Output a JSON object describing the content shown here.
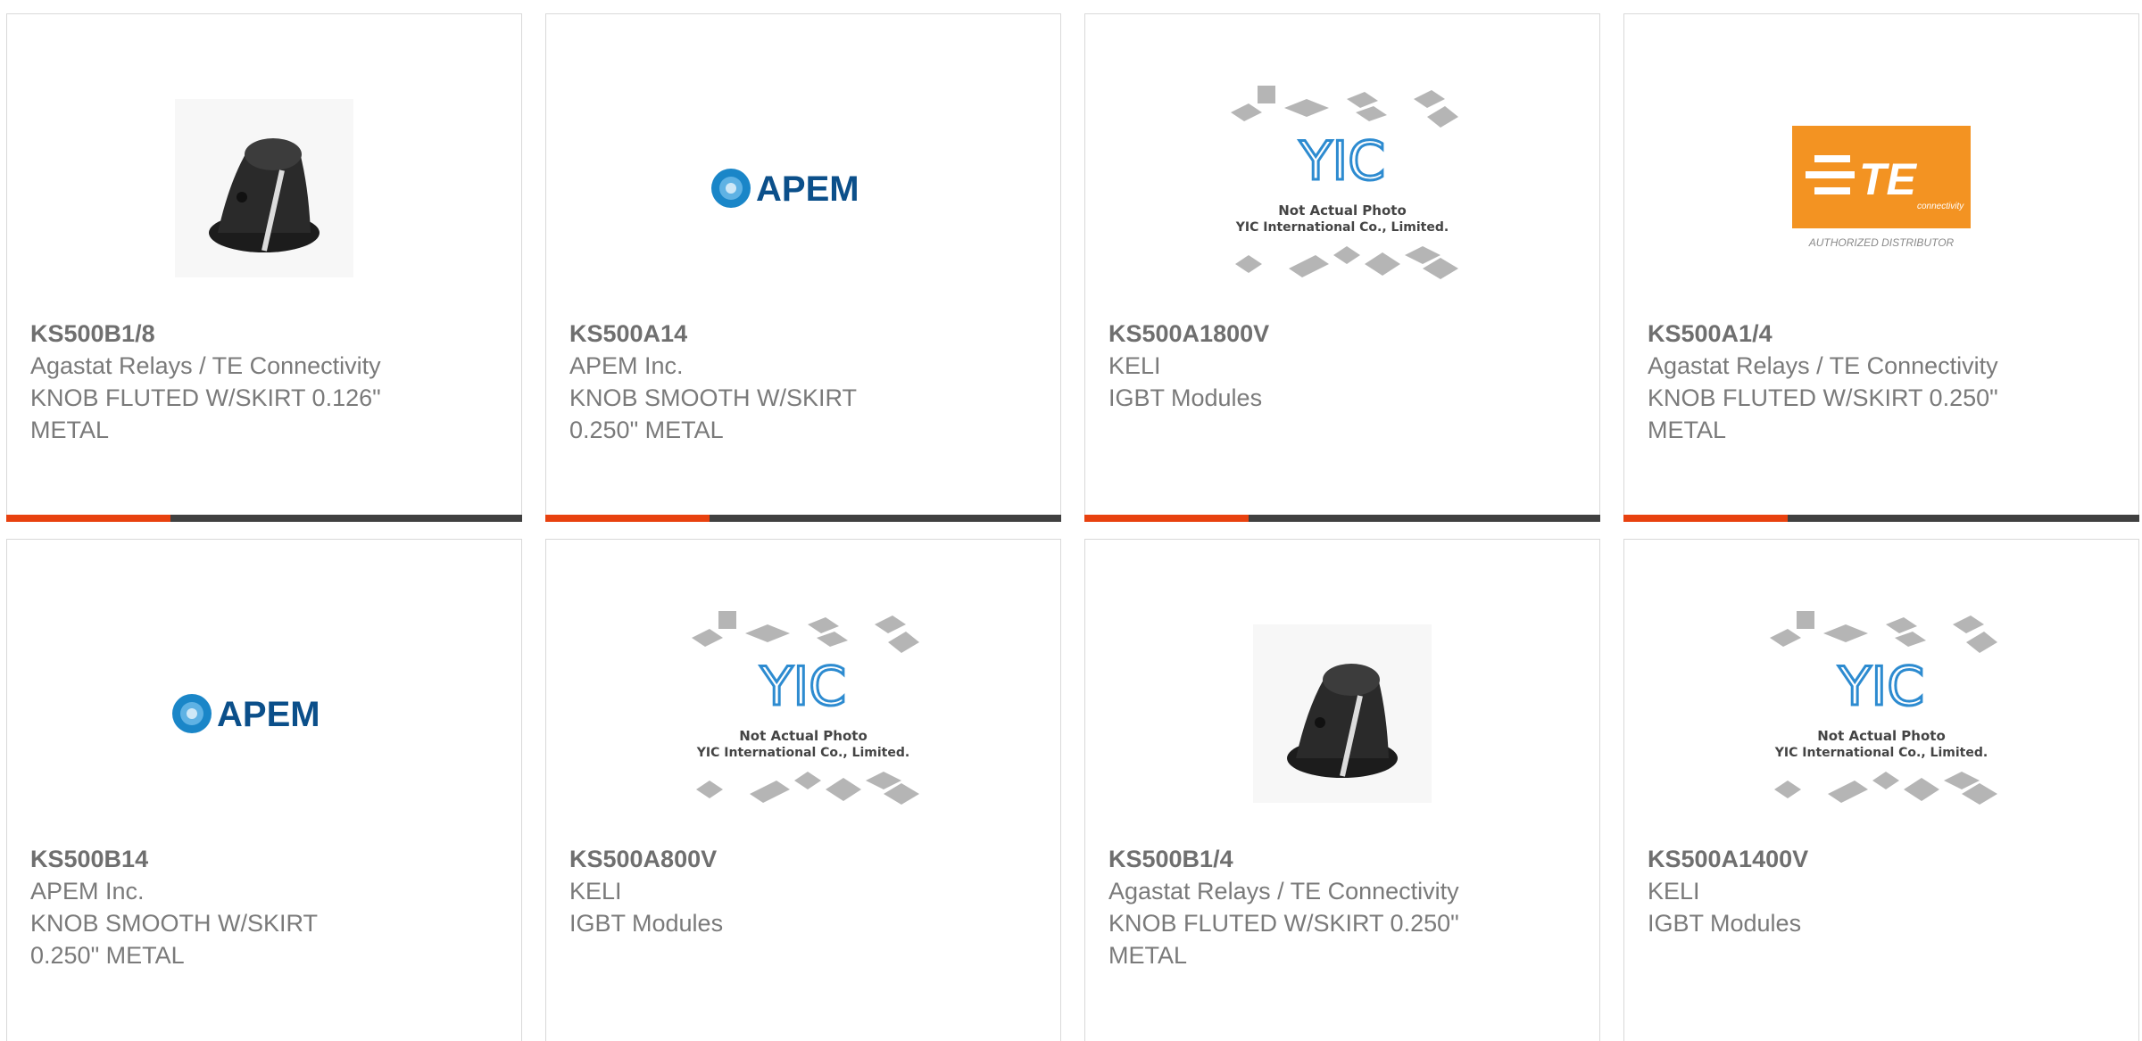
{
  "products": [
    {
      "part": "KS500B1/8",
      "maker": "Agastat Relays / TE Connectivity",
      "desc": "KNOB FLUTED W/SKIRT 0.126\" METAL",
      "image": "knob-photo"
    },
    {
      "part": "KS500A14",
      "maker": "APEM Inc.",
      "desc": "KNOB SMOOTH W/SKIRT 0.250\" METAL",
      "image": "apem-logo"
    },
    {
      "part": "KS500A1800V",
      "maker": "KELI",
      "desc": "IGBT Modules",
      "image": "yic-placeholder"
    },
    {
      "part": "KS500A1/4",
      "maker": "Agastat Relays / TE Connectivity",
      "desc": "KNOB FLUTED W/SKIRT 0.250\" METAL",
      "image": "te-logo"
    },
    {
      "part": "KS500B14",
      "maker": "APEM Inc.",
      "desc": "KNOB SMOOTH W/SKIRT 0.250\" METAL",
      "image": "apem-logo"
    },
    {
      "part": "KS500A800V",
      "maker": "KELI",
      "desc": "IGBT Modules",
      "image": "yic-placeholder"
    },
    {
      "part": "KS500B1/4",
      "maker": "Agastat Relays / TE Connectivity",
      "desc": "KNOB FLUTED W/SKIRT 0.250\" METAL",
      "image": "knob-photo"
    },
    {
      "part": "KS500A1400V",
      "maker": "KELI",
      "desc": "IGBT Modules",
      "image": "yic-placeholder"
    }
  ],
  "logos": {
    "apem": "APEM",
    "te_brand": "TE",
    "te_sub": "connectivity",
    "te_tag": "AUTHORIZED DISTRIBUTOR",
    "yic_mark": "YIC",
    "yic_line1": "Not Actual Photo",
    "yic_line2": "YIC International Co., Limited."
  },
  "colors": {
    "accent": "#e8410f",
    "bar": "#404040",
    "te_orange": "#f39322",
    "apem_blue": "#0b4f8a"
  }
}
